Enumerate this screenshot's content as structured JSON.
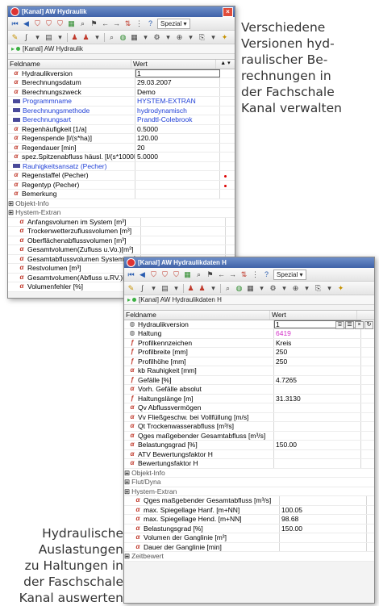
{
  "captions": {
    "top": [
      "Verschiedene",
      "Versionen hyd-",
      "raulischer Be-",
      "rechnungen in",
      "der Fachschale",
      "Kanal verwalten"
    ],
    "bottom": [
      "Hydraulische",
      "Auslastungen",
      "zu Haltungen in",
      "der Faschschale",
      "Kanal auswerten"
    ]
  },
  "window1": {
    "title": "[Kanal] AW Hydraulik",
    "path": "[Kanal] AW Hydraulik",
    "special_label": "Spezial",
    "columns": [
      "Feldname",
      "Wert"
    ],
    "rows": [
      {
        "icon": "a",
        "label": "Hydraulikversion",
        "value": "1",
        "sel": true
      },
      {
        "icon": "a",
        "label": "Berechnungsdatum",
        "value": "29.03.2007"
      },
      {
        "icon": "a",
        "label": "Berechnungszweck",
        "value": "Demo"
      },
      {
        "icon": "db",
        "label": "Programmname",
        "value": "HYSTEM-EXTRAN",
        "blue": true
      },
      {
        "icon": "db",
        "label": "Berechnungsmethode",
        "value": "hydrodynamisch",
        "blue": true
      },
      {
        "icon": "db",
        "label": "Berechnungsart",
        "value": "Prandtl-Colebrook",
        "blue": true
      },
      {
        "icon": "a",
        "label": "Regenhäufigkeit [1/a]",
        "value": "0.5000"
      },
      {
        "icon": "a",
        "label": "Regenspende [l/(s*ha)]",
        "value": "120.00"
      },
      {
        "icon": "a",
        "label": "Regendauer [min]",
        "value": "20"
      },
      {
        "icon": "a",
        "label": "spez.Spitzenabfluss häusl. [l/(s*1000E)]",
        "value": "5.0000"
      },
      {
        "icon": "db",
        "label": "Rauhigkeitsansatz (Pecher)",
        "value": "",
        "blue": true
      },
      {
        "icon": "a",
        "label": "Regenstaffel (Pecher)",
        "value": "",
        "dot": true
      },
      {
        "icon": "a",
        "label": "Regentyp (Pecher)",
        "value": "",
        "dot": true
      },
      {
        "icon": "a",
        "label": "Bemerkung",
        "value": ""
      },
      {
        "group": "Objekt-Info"
      },
      {
        "group": "Hystem-Extran"
      },
      {
        "icon": "a",
        "label": "Anfangsvolumen im System [m³]",
        "value": "",
        "indent": true
      },
      {
        "icon": "a",
        "label": "Trockenwetterzuflussvolumen [m³]",
        "value": "",
        "indent": true
      },
      {
        "icon": "a",
        "label": "Oberflächenabflussvolumen [m³]",
        "value": "",
        "indent": true
      },
      {
        "icon": "a",
        "label": "Gesamtvolumen(Zufluss u.Vo.)[m³]",
        "value": "",
        "indent": true
      },
      {
        "icon": "a",
        "label": "Gesamtabflussvolumen System [m³]",
        "value": "",
        "indent": true
      },
      {
        "icon": "a",
        "label": "Restvolumen [m³]",
        "value": "",
        "indent": true
      },
      {
        "icon": "a",
        "label": "Gesamtvolumen(Abfluss u.RV.)[m³]",
        "value": "",
        "indent": true
      },
      {
        "icon": "a",
        "label": "Volumenfehler [%]",
        "value": "",
        "indent": true
      }
    ]
  },
  "window2": {
    "title": "[Kanal] AW Hydraulikdaten H",
    "path": "[Kanal] AW Hydraulikdaten H",
    "special_label": "Spezial",
    "columns": [
      "Feldname",
      "Wert"
    ],
    "rows": [
      {
        "icon": "g",
        "label": "Hydraulikversion",
        "value": "1",
        "sel": true,
        "ctrls": true
      },
      {
        "icon": "g",
        "label": "Haltung",
        "value": "6419",
        "pink": true
      },
      {
        "icon": "f",
        "label": "Profilkennzeichen",
        "value": "Kreis"
      },
      {
        "icon": "f",
        "label": "Profilbreite [mm]",
        "value": "250"
      },
      {
        "icon": "f",
        "label": "Profilhöhe [mm]",
        "value": "250"
      },
      {
        "icon": "a",
        "label": "kb Rauhigkeit [mm]",
        "value": ""
      },
      {
        "icon": "f",
        "label": "Gefälle [%]",
        "value": "4.7265"
      },
      {
        "icon": "a",
        "label": "Vorh. Gefälle absolut",
        "value": ""
      },
      {
        "icon": "f",
        "label": "Haltungslänge [m]",
        "value": "31.3130"
      },
      {
        "icon": "a",
        "label": "Qv Abflussvermögen",
        "value": ""
      },
      {
        "icon": "a",
        "label": "Vv Fließgeschw. bei Vollfüllung [m/s]",
        "value": ""
      },
      {
        "icon": "a",
        "label": "Qt Trockenwasserabfluss [m³/s]",
        "value": ""
      },
      {
        "icon": "a",
        "label": "Qges maßgebender Gesamtabfluss [m³/s]",
        "value": ""
      },
      {
        "icon": "a",
        "label": "Belastungsgrad [%]",
        "value": "150.00"
      },
      {
        "icon": "a",
        "label": "ATV Bewertungsfaktor H",
        "value": ""
      },
      {
        "icon": "a",
        "label": "Bewertungsfaktor H",
        "value": ""
      },
      {
        "group": "Objekt-Info"
      },
      {
        "group": "Flut/Dyna"
      },
      {
        "group": "Hystem-Extran"
      },
      {
        "icon": "a",
        "label": "Qges maßgebender Gesamtabfluss [m³/s]",
        "value": "",
        "indent": true
      },
      {
        "icon": "a",
        "label": "max. Spiegellage Hanf. [m+NN]",
        "value": "100.05",
        "indent": true
      },
      {
        "icon": "a",
        "label": "max. Spiegellage Hend. [m+NN]",
        "value": "98.68",
        "indent": true
      },
      {
        "icon": "a",
        "label": "Belastungsgrad [%]",
        "value": "150.00",
        "indent": true
      },
      {
        "icon": "a",
        "label": "Volumen der Ganglinie [m³]",
        "value": "",
        "indent": true
      },
      {
        "icon": "a",
        "label": "Dauer der Ganglinie [min]",
        "value": "",
        "indent": true
      },
      {
        "group": "Zeitbewert"
      }
    ]
  }
}
